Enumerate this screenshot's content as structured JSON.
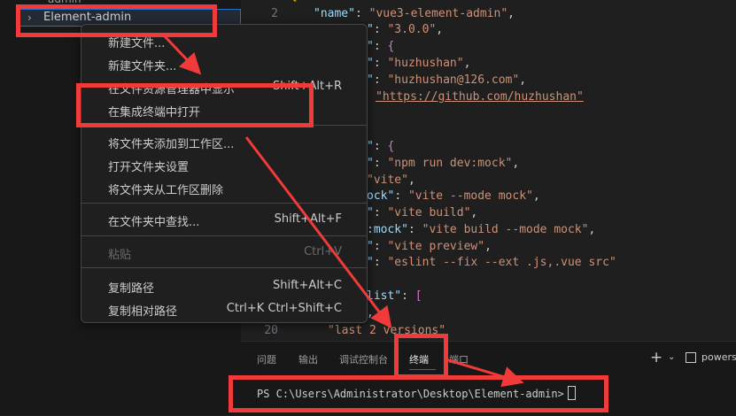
{
  "explorer": {
    "cut_item": "admin",
    "folder_label": "Element-admin"
  },
  "editor": {
    "line_numbers": [
      "2",
      "20"
    ],
    "lines": {
      "l2_key": "\"name\"",
      "l2_val": "\"vue3-element-admin\"",
      "l3_key": "\"",
      "l3_val": "\"3.0.0\"",
      "l4_key": "\"",
      "l5_key": "\"",
      "l5_val": "\"huzhushan\"",
      "l6_key": "\"",
      "l6_val": "\"huzhushan@126.com\"",
      "l7_val": "\"https://github.com/huzhushan\"",
      "l9_key": "\"",
      "l10_key": "\"",
      "l10_val": "\"npm run dev:mock\"",
      "l11_val": "\"vite\"",
      "l12_key": "ock\"",
      "l12_val": "\"vite --mode mock\"",
      "l13_key": "\"",
      "l13_val": "\"vite build\"",
      "l14_key": ":mock\"",
      "l14_val": "\"vite build --mode mock\"",
      "l15_key": "\"",
      "l15_val": "\"vite preview\"",
      "l16_key": "\"",
      "l16_val": "\"eslint --fix --ext .js,.vue src\"",
      "l18_key": "list\"",
      "l20_val": "\"last 2 versions\""
    }
  },
  "context_menu": {
    "items": [
      {
        "label": "新建文件...",
        "shortcut": ""
      },
      {
        "label": "新建文件夹...",
        "shortcut": ""
      },
      {
        "label": "在文件资源管理器中显示",
        "shortcut": "Shift+Alt+R"
      },
      {
        "label": "在集成终端中打开",
        "shortcut": ""
      },
      {
        "label": "将文件夹添加到工作区...",
        "shortcut": ""
      },
      {
        "label": "打开文件夹设置",
        "shortcut": ""
      },
      {
        "label": "将文件夹从工作区删除",
        "shortcut": ""
      },
      {
        "label": "在文件夹中查找...",
        "shortcut": "Shift+Alt+F"
      },
      {
        "label": "粘贴",
        "shortcut": "Ctrl+V"
      },
      {
        "label": "复制路径",
        "shortcut": "Shift+Alt+C"
      },
      {
        "label": "复制相对路径",
        "shortcut": "Ctrl+K Ctrl+Shift+C"
      }
    ]
  },
  "panel": {
    "tabs": [
      "问题",
      "输出",
      "调试控制台",
      "终端",
      "端口"
    ],
    "active_tab": "终端",
    "plus": "+",
    "shell_label": "powersh",
    "prompt": "PS C:\\Users\\Administrator\\Desktop\\Element-admin>"
  },
  "colors": {
    "annotation_red": "#f13a3a",
    "accent": "#0078d4"
  }
}
